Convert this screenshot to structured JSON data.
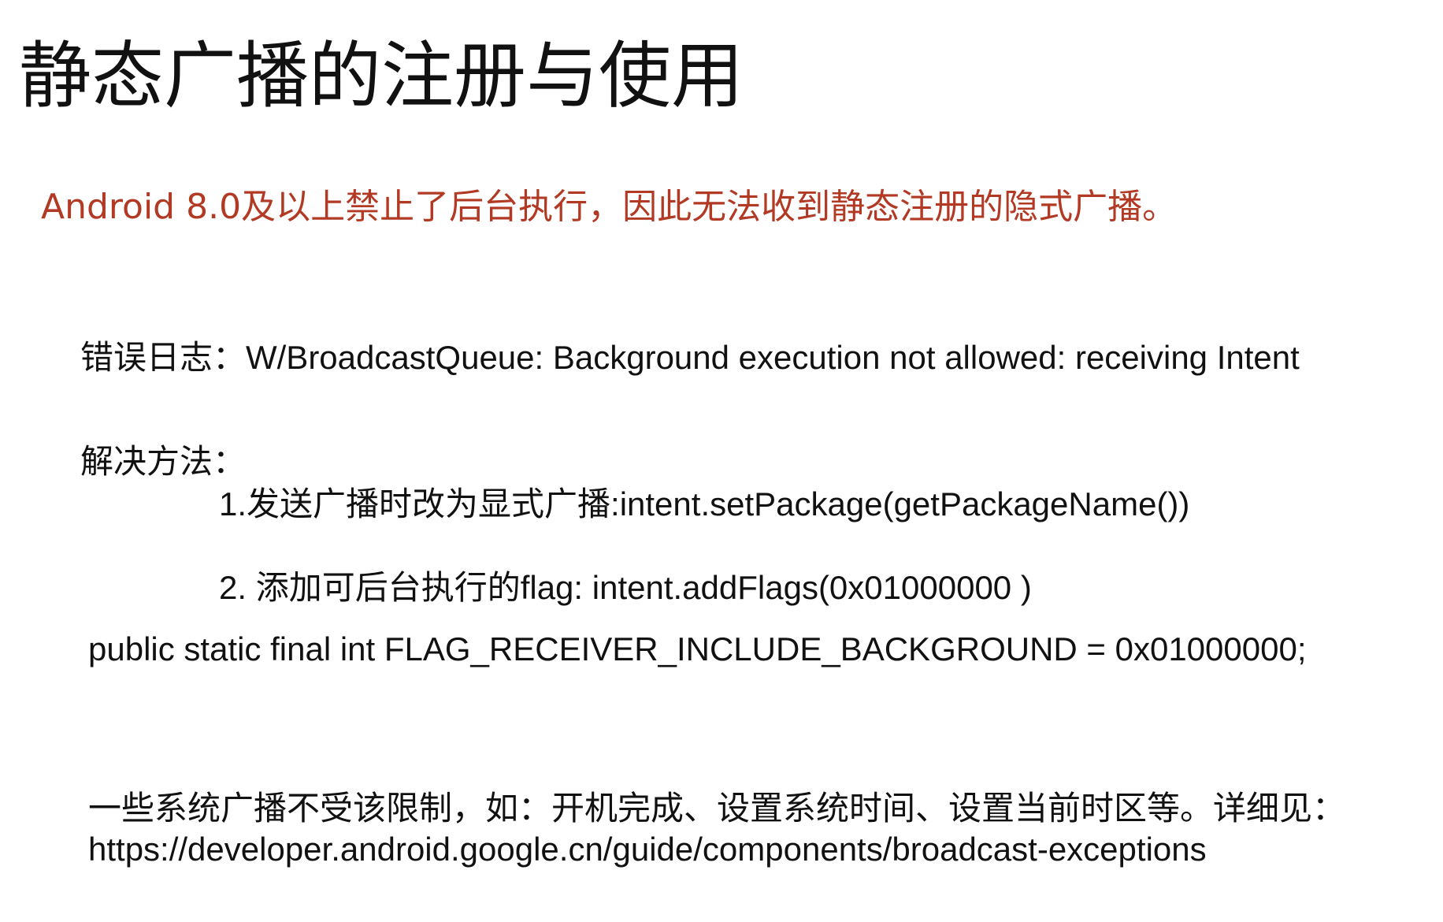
{
  "title": "静态广播的注册与使用",
  "warning": "Android 8.0及以上禁止了后台执行，因此无法收到静态注册的隐式广播。",
  "error_log": "错误日志：W/BroadcastQueue: Background execution not allowed: receiving Intent",
  "solution": {
    "heading": "解决方法：",
    "steps": [
      "1.发送广播时改为显式广播:intent.setPackage(getPackageName())",
      "2. 添加可后台执行的flag: intent.addFlags(0x01000000 )"
    ],
    "constant": "public static final int FLAG_RECEIVER_INCLUDE_BACKGROUND = 0x01000000;"
  },
  "exceptions": {
    "note": "一些系统广播不受该限制，如：开机完成、设置系统时间、设置当前时区等。详细见：",
    "link": "https://developer.android.google.cn/guide/components/broadcast-exceptions"
  },
  "colors": {
    "warning": "#b23a24",
    "text": "#111111",
    "background": "#ffffff"
  }
}
